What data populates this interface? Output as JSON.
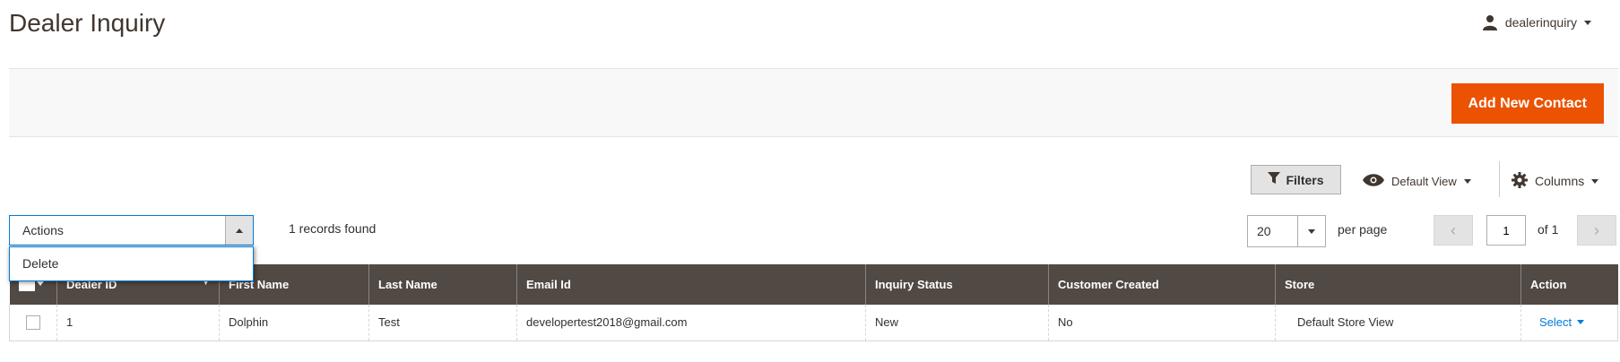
{
  "page": {
    "title": "Dealer Inquiry"
  },
  "user": {
    "name": "dealerinquiry",
    "icon": "user-icon"
  },
  "action_bar": {
    "add_button": "Add New Contact"
  },
  "toolbar": {
    "filters_label": "Filters",
    "view_label": "Default View",
    "columns_label": "Columns"
  },
  "mass_actions": {
    "label": "Actions",
    "options": [
      "Delete"
    ]
  },
  "records_found": "1 records found",
  "pagination": {
    "per_page_value": "20",
    "per_page_label": "per page",
    "current_page": "1",
    "of_label": "of 1"
  },
  "grid": {
    "columns": [
      "Dealer ID",
      "First Name",
      "Last Name",
      "Email Id",
      "Inquiry Status",
      "Customer Created",
      "Store",
      "Action"
    ],
    "rows": [
      {
        "dealer_id": "1",
        "first_name": "Dolphin",
        "last_name": "Test",
        "email": "developertest2018@gmail.com",
        "status": "New",
        "customer_created": "No",
        "store": "Default Store View",
        "action": "Select"
      }
    ]
  },
  "colors": {
    "accent": "#eb5202",
    "header_bg": "#514943",
    "link": "#007bdb"
  }
}
